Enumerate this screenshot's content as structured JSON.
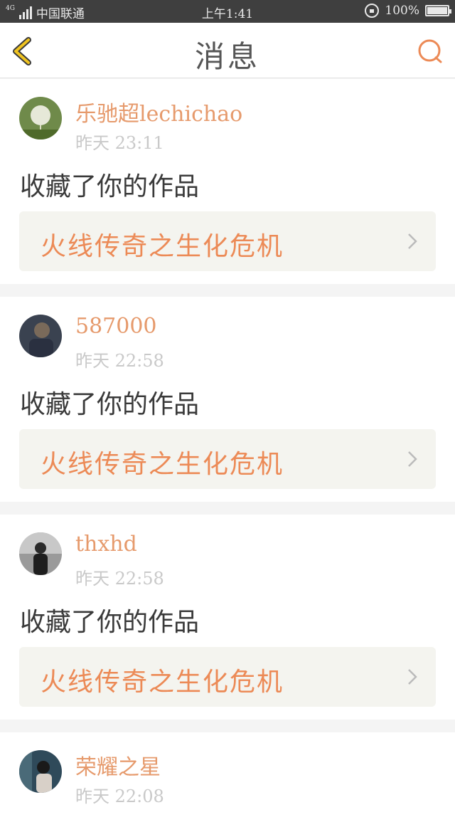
{
  "status_bar": {
    "network": "4G",
    "carrier": "中国联通",
    "time": "上午1:41",
    "battery_pct": "100%"
  },
  "nav": {
    "title": "消息",
    "back_icon": "chevron-left-icon",
    "search_icon": "search-icon"
  },
  "messages": [
    {
      "username": "乐驰超lechichao",
      "time": "昨天 23:11",
      "action": "收藏了你的作品",
      "work_title": "火线传奇之生化危机",
      "avatar_color": "#6f8a4a"
    },
    {
      "username": "587000",
      "time": "昨天 22:58",
      "action": "收藏了你的作品",
      "work_title": "火线传奇之生化危机",
      "avatar_color": "#3a4250"
    },
    {
      "username": "thxhd",
      "time": "昨天 22:58",
      "action": "收藏了你的作品",
      "work_title": "火线传奇之生化危机",
      "avatar_color": "#555555"
    },
    {
      "username": "荣耀之星",
      "time": "昨天 22:08",
      "avatar_color": "#2f4a5a"
    }
  ],
  "colors": {
    "accent": "#ec8a56",
    "username": "#e69a6c",
    "back_icon": "#f0c420",
    "status_bar": "#3f3f3f"
  }
}
